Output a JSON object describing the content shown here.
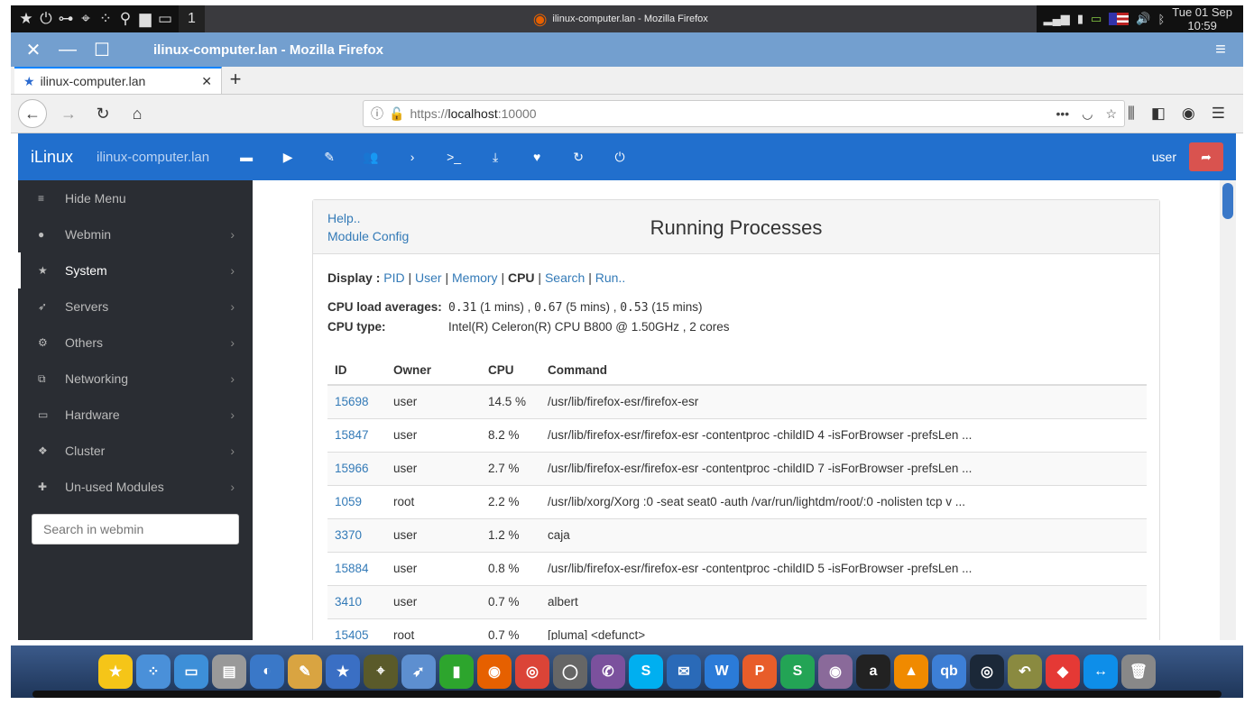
{
  "system_panel": {
    "workspace": "1",
    "active_window": "ilinux-computer.lan - Mozilla Firefox",
    "clock_day": "Tue 01 Sep",
    "clock_time": "10:59",
    "icons": [
      "star-icon",
      "power-icon",
      "toggle-icon",
      "binoculars-icon",
      "apps-icon",
      "search-icon",
      "folder-icon",
      "tablet-icon"
    ],
    "tray": [
      "signal-icon",
      "usb-icon",
      "battery-icon",
      "us-flag-icon",
      "volume-icon",
      "bluetooth-icon"
    ]
  },
  "window": {
    "title": "ilinux-computer.lan - Mozilla Firefox"
  },
  "browser": {
    "tab_title": "ilinux-computer.lan",
    "url_scheme": "https://",
    "url_host": "localhost",
    "url_port": ":10000"
  },
  "webmin": {
    "brand": "iLinux",
    "host": "ilinux-computer.lan",
    "user": "user",
    "header_icons": [
      "folder-icon",
      "play-icon",
      "pencil-icon",
      "users-icon",
      "chevron-right-icon",
      "terminal-icon",
      "download-icon",
      "heartbeat-icon",
      "refresh-icon",
      "power-icon"
    ]
  },
  "sidebar": {
    "items": [
      {
        "label": "Hide Menu",
        "icon": "≡",
        "chev": false
      },
      {
        "label": "Webmin",
        "icon": "●",
        "chev": true
      },
      {
        "label": "System",
        "icon": "★",
        "chev": true,
        "active": true
      },
      {
        "label": "Servers",
        "icon": "➶",
        "chev": true
      },
      {
        "label": "Others",
        "icon": "⚙",
        "chev": true
      },
      {
        "label": "Networking",
        "icon": "⧉",
        "chev": true
      },
      {
        "label": "Hardware",
        "icon": "▭",
        "chev": true
      },
      {
        "label": "Cluster",
        "icon": "❖",
        "chev": true
      },
      {
        "label": "Un-used Modules",
        "icon": "✚",
        "chev": true
      }
    ],
    "search_placeholder": "Search in webmin"
  },
  "page": {
    "help": "Help..",
    "module_config": "Module Config",
    "title": "Running Processes",
    "display_label": "Display :",
    "display_links": [
      "PID",
      "User",
      "Memory"
    ],
    "display_current": "CPU",
    "display_links2": [
      "Search",
      "Run.."
    ],
    "load_label": "CPU load averages:",
    "load": [
      {
        "v": "0.31",
        "l": "(1 mins)"
      },
      {
        "v": "0.67",
        "l": "(5 mins)"
      },
      {
        "v": "0.53",
        "l": "(15 mins)"
      }
    ],
    "cpu_type_label": "CPU type:",
    "cpu_type": "Intel(R) Celeron(R) CPU B800 @ 1.50GHz , 2 cores",
    "columns": [
      "ID",
      "Owner",
      "CPU",
      "Command"
    ],
    "rows": [
      [
        "15698",
        "user",
        "14.5 %",
        "/usr/lib/firefox-esr/firefox-esr"
      ],
      [
        "15847",
        "user",
        "8.2 %",
        "/usr/lib/firefox-esr/firefox-esr -contentproc -childID 4 -isForBrowser -prefsLen ..."
      ],
      [
        "15966",
        "user",
        "2.7 %",
        "/usr/lib/firefox-esr/firefox-esr -contentproc -childID 7 -isForBrowser -prefsLen ..."
      ],
      [
        "1059",
        "root",
        "2.2 %",
        "/usr/lib/xorg/Xorg :0 -seat seat0 -auth /var/run/lightdm/root/:0 -nolisten tcp v ..."
      ],
      [
        "3370",
        "user",
        "1.2 %",
        "caja"
      ],
      [
        "15884",
        "user",
        "0.8 %",
        "/usr/lib/firefox-esr/firefox-esr -contentproc -childID 5 -isForBrowser -prefsLen ..."
      ],
      [
        "3410",
        "user",
        "0.7 %",
        "albert"
      ],
      [
        "15405",
        "root",
        "0.7 %",
        "[pluma] <defunct>"
      ]
    ]
  },
  "dock": [
    {
      "name": "star-app",
      "c": "#f5c518",
      "g": "★"
    },
    {
      "name": "dots-app",
      "c": "#4a90d9",
      "g": "⁘"
    },
    {
      "name": "window-app",
      "c": "#3d8fd8",
      "g": "▭"
    },
    {
      "name": "cabinet-app",
      "c": "#999",
      "g": "▤"
    },
    {
      "name": "toggle-app",
      "c": "#3a78c8",
      "g": "◐"
    },
    {
      "name": "palette-app",
      "c": "#d9a441",
      "g": "✎"
    },
    {
      "name": "store-app",
      "c": "#3a6fc4",
      "g": "★"
    },
    {
      "name": "binoculars-app",
      "c": "#5a5a2a",
      "g": "⌖"
    },
    {
      "name": "rocket-app",
      "c": "#5d8fd0",
      "g": "➶"
    },
    {
      "name": "pipe-app",
      "c": "#2da52d",
      "g": "▮"
    },
    {
      "name": "firefox-app",
      "c": "#e66000",
      "g": "◉"
    },
    {
      "name": "chrome-app",
      "c": "#db4437",
      "g": "◎"
    },
    {
      "name": "disk-app",
      "c": "#666",
      "g": "◯"
    },
    {
      "name": "viber-app",
      "c": "#7b519d",
      "g": "✆"
    },
    {
      "name": "skype-app",
      "c": "#00aff0",
      "g": "S"
    },
    {
      "name": "mail-app",
      "c": "#2a6ab8",
      "g": "✉"
    },
    {
      "name": "writer-app",
      "c": "#2b7bd8",
      "g": "W"
    },
    {
      "name": "presentation-app",
      "c": "#e85d2a",
      "g": "P"
    },
    {
      "name": "spreadsheet-app",
      "c": "#23a455",
      "g": "S"
    },
    {
      "name": "webcam-app",
      "c": "#8a6a9a",
      "g": "◉"
    },
    {
      "name": "a-app",
      "c": "#222",
      "g": "a"
    },
    {
      "name": "vlc-app",
      "c": "#f08a00",
      "g": "▲"
    },
    {
      "name": "qbittorrent-app",
      "c": "#3d7fd6",
      "g": "qb"
    },
    {
      "name": "steam-app",
      "c": "#1b2838",
      "g": "◎"
    },
    {
      "name": "back-app",
      "c": "#8a8a40",
      "g": "↶"
    },
    {
      "name": "anydesk-app",
      "c": "#e53935",
      "g": "◆"
    },
    {
      "name": "teamviewer-app",
      "c": "#0e8ee9",
      "g": "↔"
    },
    {
      "name": "trash-app",
      "c": "#888",
      "g": "🗑"
    }
  ]
}
